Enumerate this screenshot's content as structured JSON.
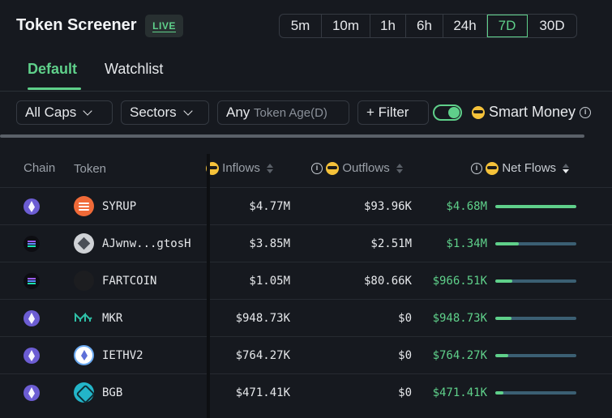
{
  "header": {
    "title": "Token Screener",
    "badge": "LIVE"
  },
  "timeframes": [
    {
      "label": "5m",
      "active": false
    },
    {
      "label": "10m",
      "active": false
    },
    {
      "label": "1h",
      "active": false
    },
    {
      "label": "6h",
      "active": false
    },
    {
      "label": "24h",
      "active": false
    },
    {
      "label": "7D",
      "active": true
    },
    {
      "label": "30D",
      "active": false
    }
  ],
  "tabs": {
    "default": "Default",
    "watchlist": "Watchlist"
  },
  "filters": {
    "caps": "All Caps",
    "sectors": "Sectors",
    "age_value": "Any",
    "age_label": "Token Age(D)",
    "filter": "Filter",
    "smart_money": "Smart Money",
    "smart_money_enabled": true
  },
  "columns": {
    "chain": "Chain",
    "token": "Token",
    "inflows": "Inflows",
    "outflows": "Outflows",
    "net_flows": "Net Flows"
  },
  "rows": [
    {
      "chain": "ethereum",
      "token": "SYRUP",
      "token_icon": "syrup-icon",
      "inflows": "$4.77M",
      "outflows": "$93.96K",
      "net": "$4.68M",
      "net_fraction": 1.0
    },
    {
      "chain": "solana",
      "token": "AJwnw...gtosH",
      "token_icon": "ajwnw-icon",
      "inflows": "$3.85M",
      "outflows": "$2.51M",
      "net": "$1.34M",
      "net_fraction": 0.29
    },
    {
      "chain": "solana",
      "token": "FARTCOIN",
      "token_icon": "fartcoin-icon",
      "inflows": "$1.05M",
      "outflows": "$80.66K",
      "net": "$966.51K",
      "net_fraction": 0.21
    },
    {
      "chain": "ethereum",
      "token": "MKR",
      "token_icon": "mkr-icon",
      "inflows": "$948.73K",
      "outflows": "$0",
      "net": "$948.73K",
      "net_fraction": 0.2
    },
    {
      "chain": "ethereum",
      "token": "IETHV2",
      "token_icon": "iethv2-icon",
      "inflows": "$764.27K",
      "outflows": "$0",
      "net": "$764.27K",
      "net_fraction": 0.16
    },
    {
      "chain": "ethereum",
      "token": "BGB",
      "token_icon": "bgb-icon",
      "inflows": "$471.41K",
      "outflows": "$0",
      "net": "$471.41K",
      "net_fraction": 0.1
    }
  ],
  "colors": {
    "accent": "#5fd08a",
    "background": "#16191f",
    "bar_track": "#3b5f73"
  }
}
